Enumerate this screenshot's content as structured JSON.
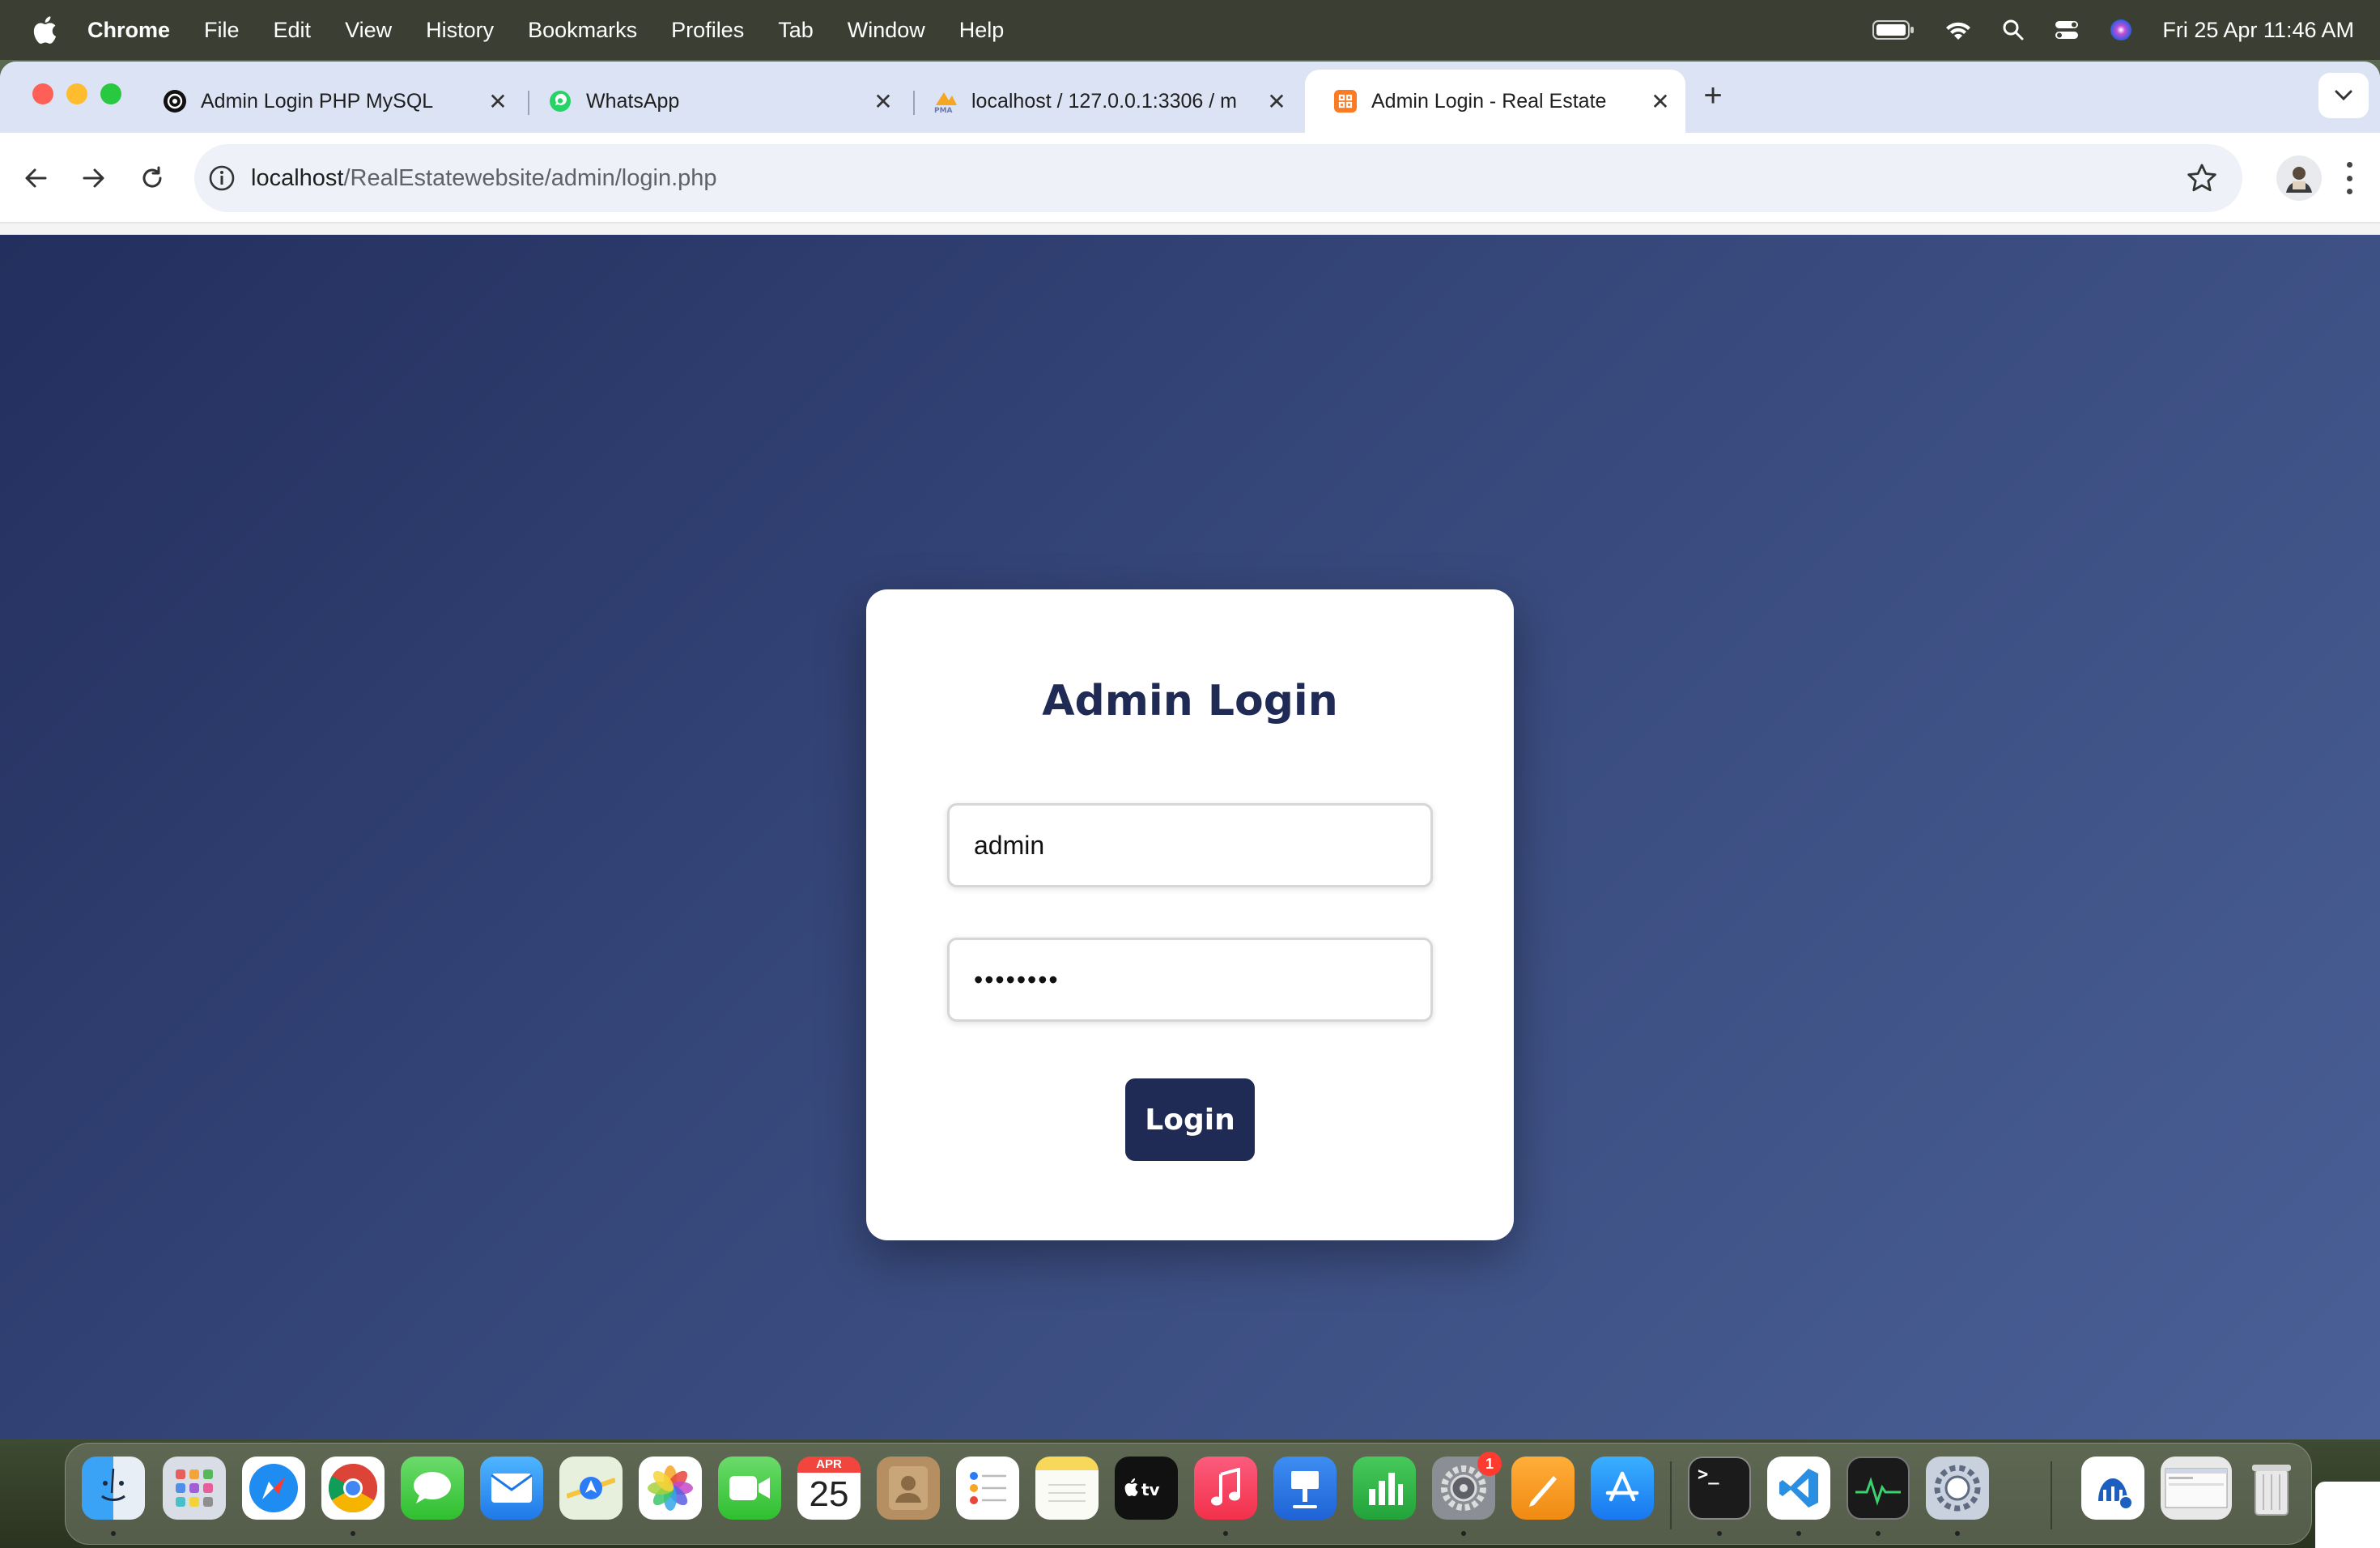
{
  "menubar": {
    "app": "Chrome",
    "items": [
      "File",
      "Edit",
      "View",
      "History",
      "Bookmarks",
      "Profiles",
      "Tab",
      "Window",
      "Help"
    ],
    "clock": "Fri 25 Apr  11:46 AM"
  },
  "tabs": [
    {
      "title": "Admin Login PHP MySQL",
      "icon": "openai-icon",
      "active": false
    },
    {
      "title": "WhatsApp",
      "icon": "whatsapp-icon",
      "active": false
    },
    {
      "title": "localhost / 127.0.0.1:3306 / m",
      "icon": "phpmyadmin-icon",
      "active": false
    },
    {
      "title": "Admin Login - Real Estate",
      "icon": "xampp-icon",
      "active": true
    }
  ],
  "address_bar": {
    "host": "localhost",
    "path": "/RealEstatewebsite/admin/login.php"
  },
  "login_form": {
    "heading": "Admin Login",
    "username_value": "admin",
    "password_value": "••••••••",
    "button_label": "Login"
  },
  "dock": {
    "calendar_month": "APR",
    "calendar_day": "25",
    "settings_badge": "1",
    "apps": [
      "Finder",
      "Launchpad",
      "Safari",
      "Chrome",
      "Messages",
      "Mail",
      "Maps",
      "Photos",
      "FaceTime",
      "Calendar",
      "Contacts",
      "Reminders",
      "Notes",
      "TV",
      "Music",
      "Keynote",
      "Numbers",
      "System Settings",
      "Pages",
      "App Store",
      "Terminal",
      "VS Code",
      "Activity Monitor",
      "Directory Utility",
      "XAMPP",
      "Screenshot",
      "Trash"
    ]
  },
  "colors": {
    "page_gradient_start": "#232f5e",
    "page_gradient_end": "#4a6096",
    "heading_color": "#1f2a55",
    "button_color": "#1f2a55"
  }
}
